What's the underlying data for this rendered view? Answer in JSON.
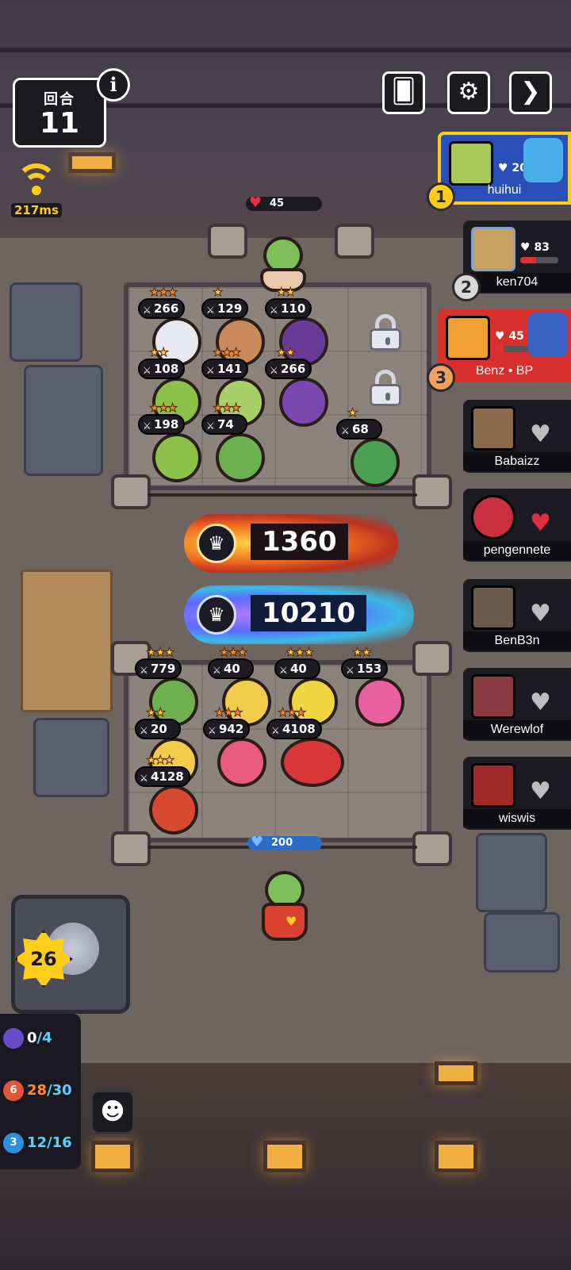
{
  "hud": {
    "round_label": "回合",
    "round_number": "11",
    "info_icon": "i",
    "ping": "217ms",
    "level": "26"
  },
  "top_buttons": [
    {
      "name": "cards-icon",
      "glyph": "🂠"
    },
    {
      "name": "gear-icon",
      "glyph": "⚙"
    },
    {
      "name": "next-icon",
      "glyph": "❯"
    }
  ],
  "players": [
    {
      "rank": "1",
      "name": "huihui",
      "hp": "200",
      "hp_fraction": 1.0,
      "alive": true
    },
    {
      "rank": "2",
      "name": "ken704",
      "hp": "83",
      "hp_fraction": 0.41,
      "alive": true
    },
    {
      "rank": "3",
      "name": "Benz • BP",
      "hp": "45",
      "hp_fraction": 0.22,
      "alive": true
    },
    {
      "name": "Babaizz",
      "alive": false
    },
    {
      "name": "pengennete",
      "alive": false
    },
    {
      "name": "BenB3n",
      "alive": false
    },
    {
      "name": "Werewlof",
      "alive": false
    },
    {
      "name": "wiswis",
      "alive": false
    }
  ],
  "enemy": {
    "hp": "45",
    "units": [
      {
        "stars": 3,
        "star_color": "orange",
        "power": "266"
      },
      {
        "stars": 1,
        "star_color": "gold",
        "power": "129"
      },
      {
        "stars": 2,
        "star_color": "gold",
        "power": "110"
      },
      {
        "stars": 2,
        "star_color": "gold",
        "power": "108"
      },
      {
        "stars": 3,
        "star_color": "orange",
        "power": "141"
      },
      {
        "stars": 2,
        "star_color": "gold",
        "power": "266"
      },
      {
        "stars": 3,
        "star_color": "orange",
        "power": "198"
      },
      {
        "stars": 3,
        "star_color": "orange",
        "power": "74"
      },
      {
        "stars": 1,
        "star_color": "gold",
        "power": "68"
      }
    ]
  },
  "player": {
    "hp": "200",
    "units": [
      {
        "stars": 3,
        "star_color": "gold",
        "power": "779"
      },
      {
        "stars": 3,
        "star_color": "orange",
        "power": "40"
      },
      {
        "stars": 3,
        "star_color": "gold",
        "power": "40"
      },
      {
        "stars": 2,
        "star_color": "gold",
        "power": "153"
      },
      {
        "stars": 2,
        "star_color": "gold",
        "power": "20"
      },
      {
        "stars": 3,
        "star_color": "orange",
        "power": "942"
      },
      {
        "stars": 3,
        "star_color": "orange",
        "power": "4108"
      },
      {
        "stars": 3,
        "star_color": "gold",
        "power": "4128"
      }
    ]
  },
  "damage": {
    "enemy_total": "1360",
    "player_total": "10210"
  },
  "resources": [
    {
      "icon": "",
      "current": "0",
      "max": "4",
      "color": "#6a4cc8"
    },
    {
      "icon": "6",
      "current": "28",
      "max": "30",
      "color": "#e2553a"
    },
    {
      "icon": "3",
      "current": "12",
      "max": "16",
      "color": "#2e8fe0"
    }
  ],
  "colors": {
    "player_first_bg": "#2b4fb8",
    "player_third_bg": "#d8302e",
    "accent_gold": "#ffcc1a"
  }
}
